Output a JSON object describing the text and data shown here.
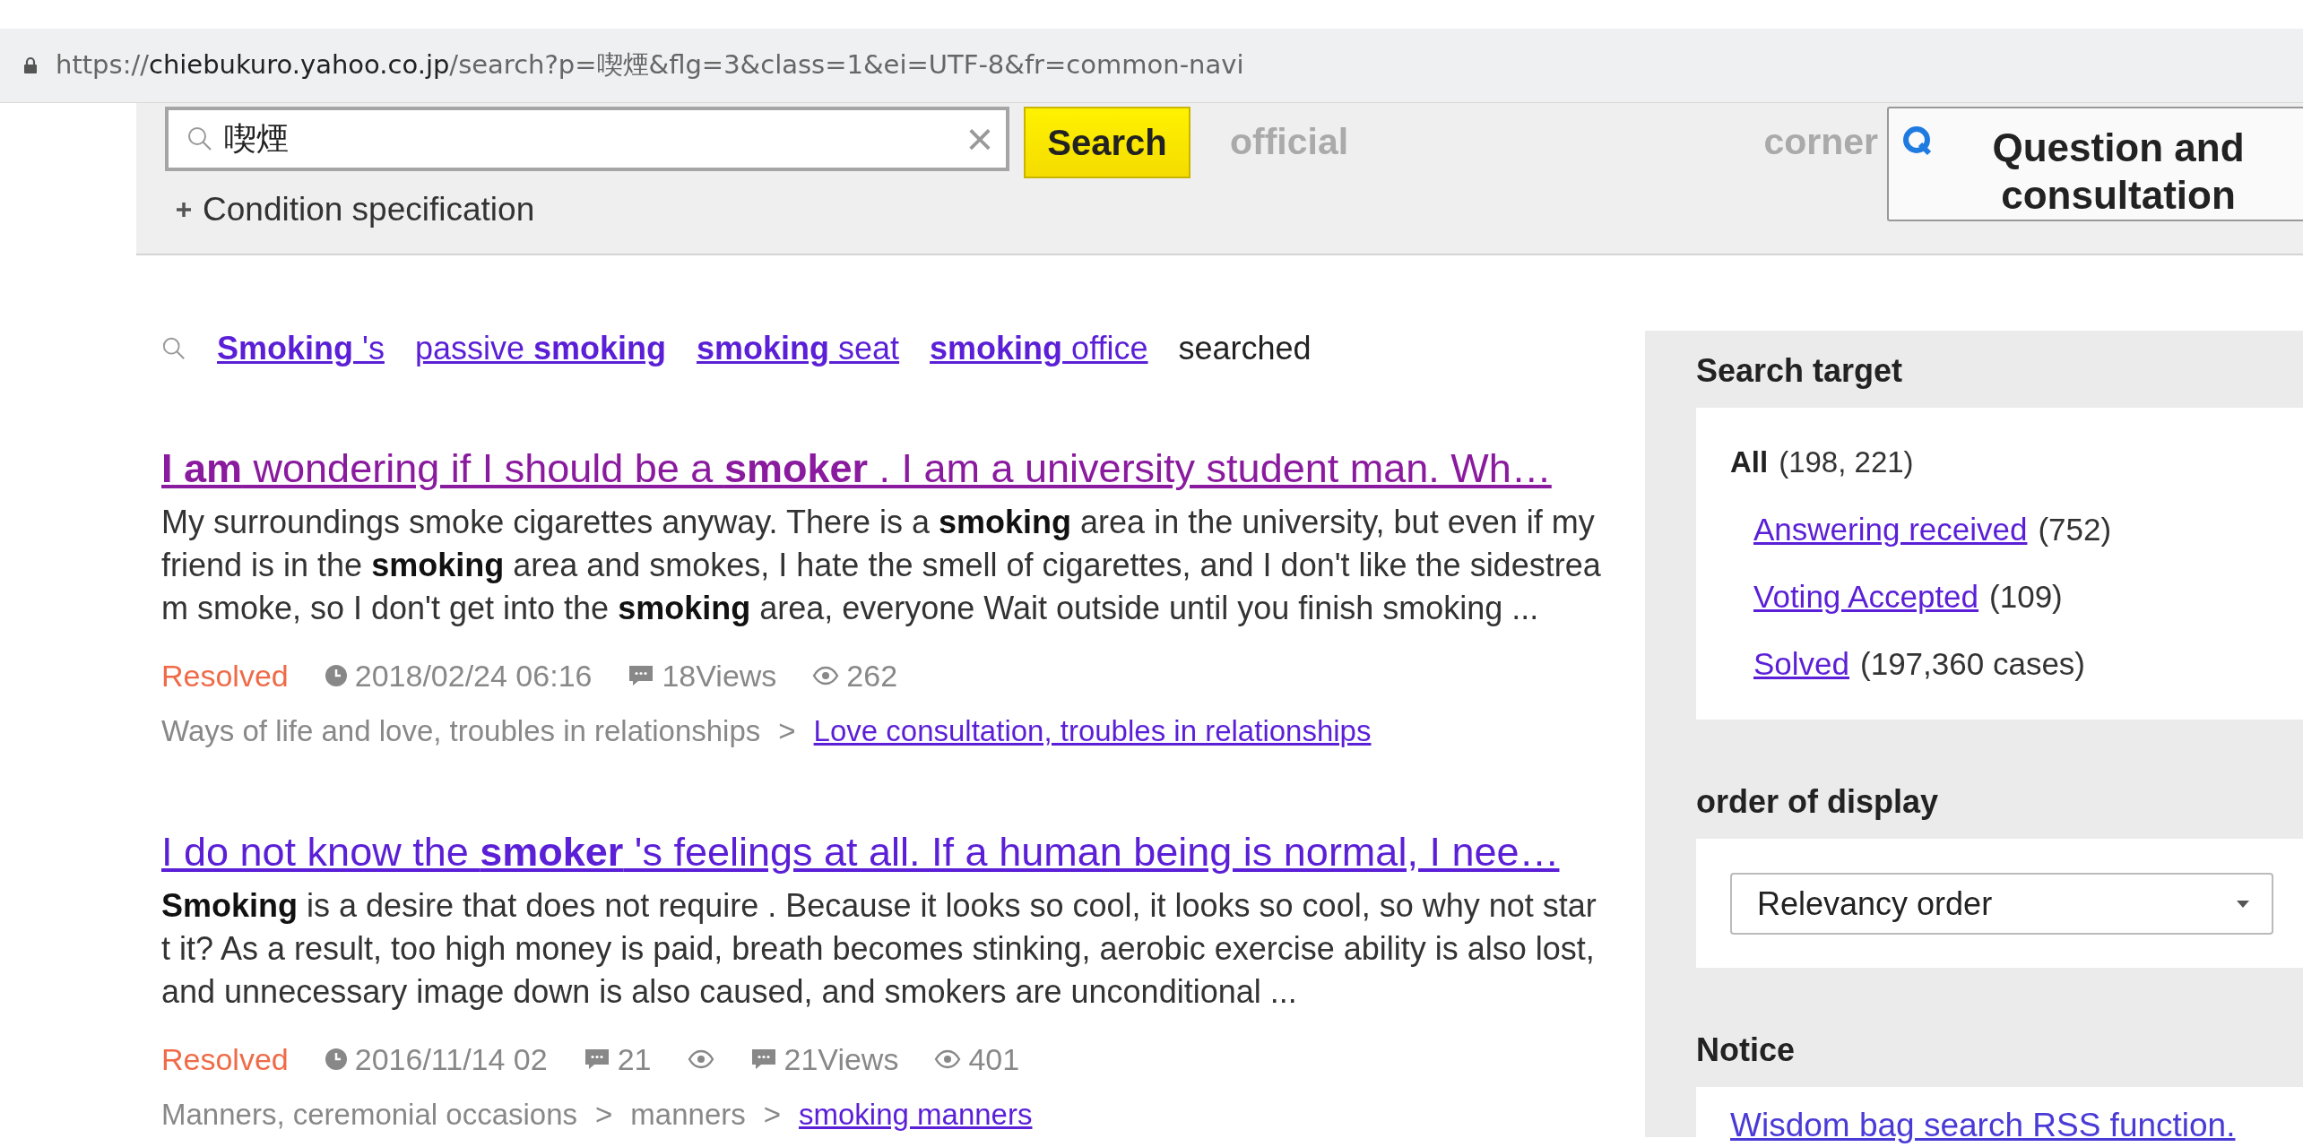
{
  "address_bar": {
    "scheme": "https://",
    "host": "chiebukuro.yahoo.co.jp",
    "path": "/search?p=喫煙&flg=3&class=1&ei=UTF-8&fr=common-navi"
  },
  "search": {
    "value": "喫煙",
    "clear": "×",
    "button": "Search",
    "condition": "Condition specification"
  },
  "header_links": [
    {
      "text": "official"
    },
    {
      "text": "corner"
    }
  ],
  "ask_button": {
    "text": "Question and consultation"
  },
  "related": {
    "items": [
      "**Smoking** 's",
      "passive **smoking**",
      "**smoking** seat",
      "**smoking** office"
    ],
    "suffix": "searched"
  },
  "results": [
    {
      "title": "**I am** wondering if I should be a **smoker** . I am a university student man. Wh…",
      "visited": true,
      "snippet": "My surroundings smoke cigarettes anyway. There is a **smoking** area in the university, but even if my friend is in the **smoking** area and smokes, I hate the smell of cigarettes, and I don't like the sidestream smoke, so I don't get into the **smoking** area, everyone Wait outside until you finish smoking ...",
      "status": "Resolved",
      "stats": [
        {
          "kind": "clock",
          "text": "2018/02/24 06:16"
        },
        {
          "kind": "comment",
          "text": "18Views"
        },
        {
          "kind": "eye",
          "text": "262"
        }
      ],
      "breadcrumb": [
        {
          "text": "Ways of life and love, troubles in relationships",
          "link": false
        },
        {
          "separator": ">",
          "text": "Love consultation, troubles in relationships",
          "link": true
        }
      ]
    },
    {
      "title": "I do not know the **smoker** 's feelings at all. If a human being is normal, I nee…",
      "visited": false,
      "snippet": "**Smoking** is a desire that does not require . Because it looks so cool, it looks so cool, so why not start it? As a result, too high money is paid, breath becomes stinking, aerobic exercise ability is also lost, and unnecessary image down is also caused, and smokers are unconditional ...",
      "status": "Resolved",
      "stats": [
        {
          "kind": "clock",
          "text": "2016/11/14 02"
        },
        {
          "kind": "comment",
          "text": "21"
        },
        {
          "kind": "eye"
        },
        {
          "kind": "comment",
          "text": "21Views"
        },
        {
          "kind": "eye",
          "text": "401"
        }
      ],
      "breadcrumb": [
        {
          "text": "Manners, ceremonial occasions",
          "link": false
        },
        {
          "separator": ">",
          "text": "manners",
          "link": false
        },
        {
          "separator": ">",
          "text": "smoking manners",
          "link": true
        }
      ]
    }
  ],
  "sidebar": {
    "search_target": {
      "title": "Search target",
      "items": [
        {
          "label": "All",
          "count": "(198, 221)",
          "selected": true
        },
        {
          "label": "Answering received",
          "count": "(752)",
          "selected": false
        },
        {
          "label": "Voting Accepted",
          "count": "(109)",
          "selected": false
        },
        {
          "label": "Solved",
          "count": "(197,360 cases)",
          "selected": false
        }
      ]
    },
    "order": {
      "title": "order of display",
      "value": "Relevancy order"
    },
    "notice": {
      "title": "Notice",
      "links": [
        "Wisdom bag search RSS function."
      ]
    }
  }
}
